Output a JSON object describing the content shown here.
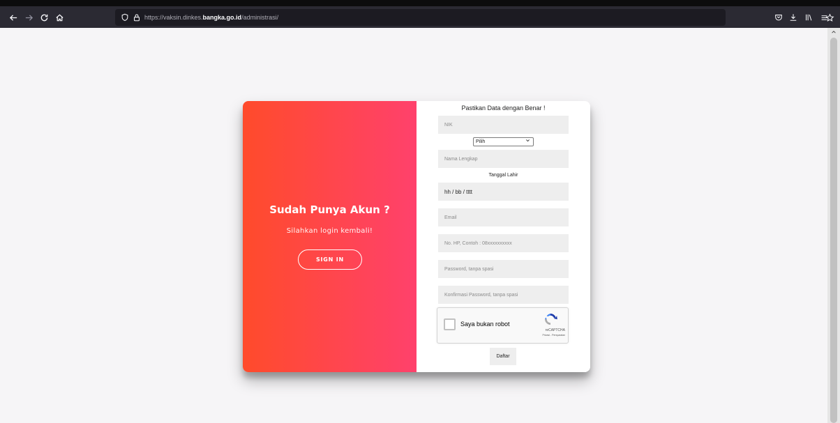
{
  "browser": {
    "url_prefix": "https://vaksin.dinkes.",
    "url_host": "bangka.go.id",
    "url_suffix": "/administrasi/"
  },
  "icons": {
    "back": "arrow-left-icon",
    "forward": "arrow-right-icon",
    "reload": "reload-icon",
    "home": "home-icon",
    "tracking": "shield-icon",
    "lock": "lock-icon",
    "bookmark": "star-icon",
    "pocket": "pocket-icon",
    "downloads": "download-icon",
    "library": "library-icon",
    "menu": "hamburger-icon",
    "scroll_up": "chevron-up-icon"
  },
  "colors": {
    "overlay_start": "#ff4b2b",
    "overlay_end": "#ff416c",
    "field_bg": "#eeeeee"
  },
  "overlay": {
    "title": "Sudah Punya Akun ?",
    "subtitle": "Silahkan login kembali!",
    "button": "SIGN IN"
  },
  "form": {
    "title": "Pastikan Data dengan Benar !",
    "nik_placeholder": "NIK",
    "select_value": "Pilih",
    "name_placeholder": "Nama Lengkap",
    "dob_label": "Tanggal Lahir",
    "dob_value": "hh / bb / tttt",
    "email_placeholder": "Email",
    "phone_placeholder": "No. HP, Contoh : 08xxxxxxxxxx",
    "password_placeholder": "Password, tanpa spasi",
    "confirm_placeholder": "Konfirmasi Password, tanpa spasi",
    "submit": "Daftar"
  },
  "recaptcha": {
    "label": "Saya bukan robot",
    "brand": "reCAPTCHA",
    "links": "Privasi - Persyaratan"
  }
}
